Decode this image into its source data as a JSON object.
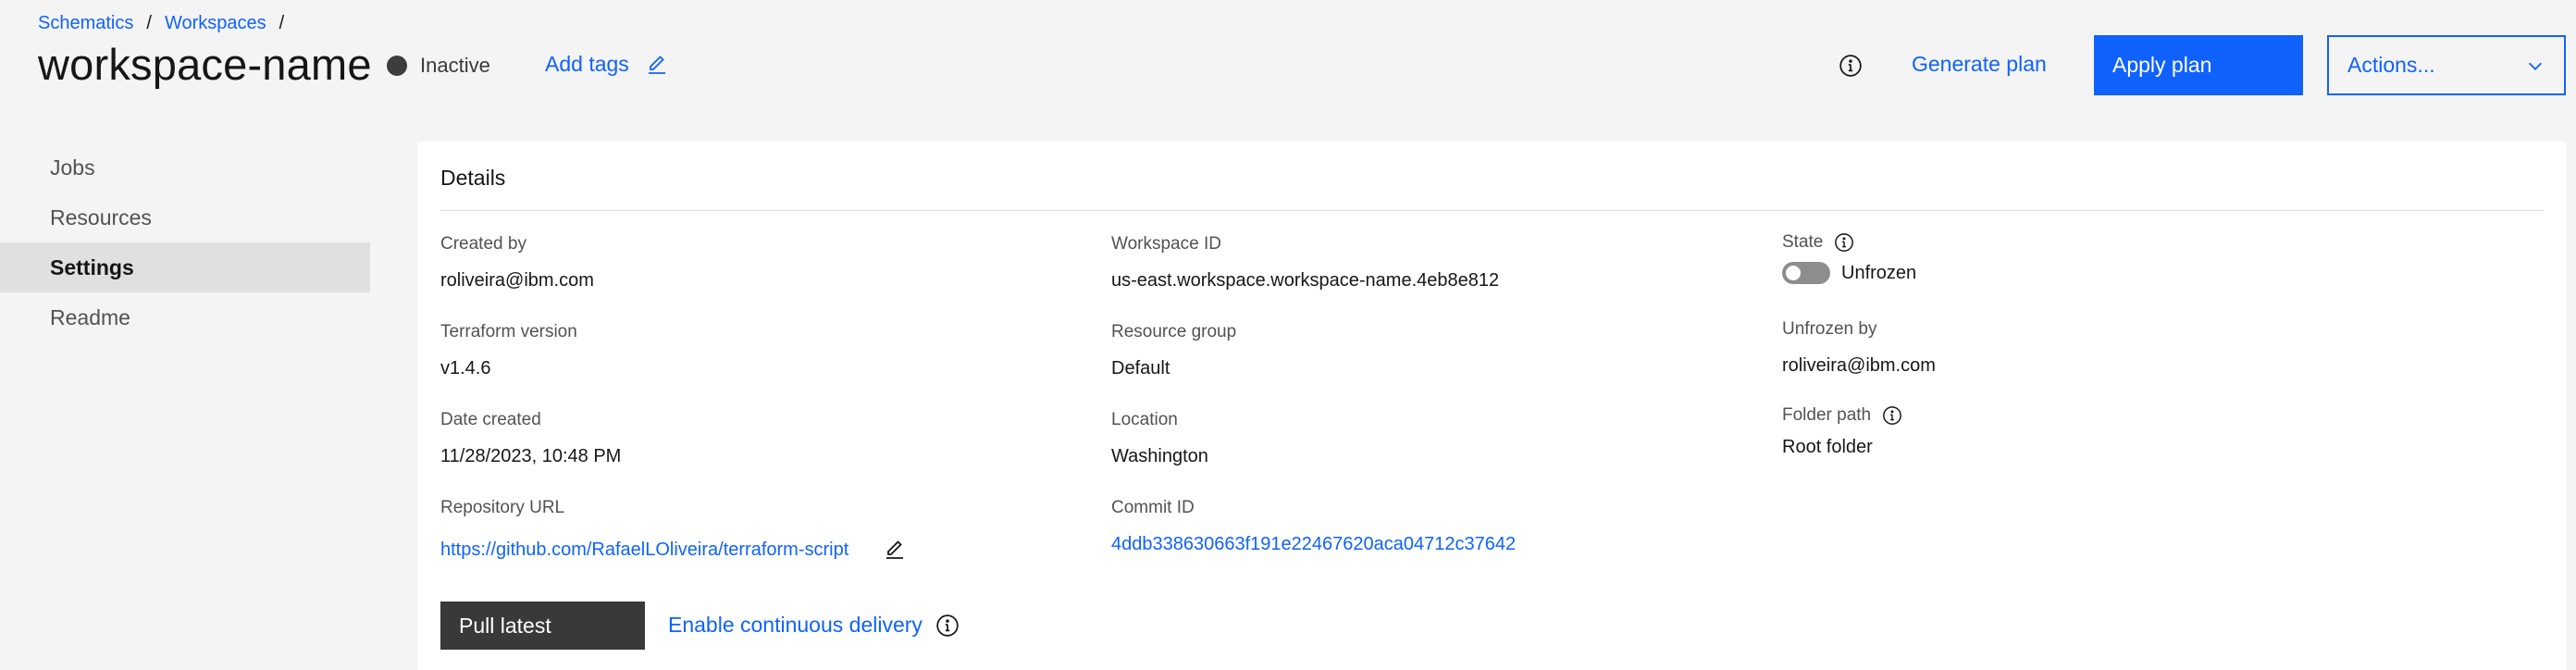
{
  "breadcrumb": {
    "items": [
      "Schematics",
      "Workspaces"
    ],
    "separator": "/"
  },
  "header": {
    "title": "workspace-name",
    "status": "Inactive",
    "add_tags": "Add tags",
    "generate_plan": "Generate plan",
    "apply_plan": "Apply plan",
    "actions": "Actions..."
  },
  "sidebar": {
    "items": [
      {
        "label": "Jobs",
        "active": false
      },
      {
        "label": "Resources",
        "active": false
      },
      {
        "label": "Settings",
        "active": true
      },
      {
        "label": "Readme",
        "active": false
      }
    ]
  },
  "details": {
    "title": "Details",
    "created_by": {
      "label": "Created by",
      "value": "roliveira@ibm.com"
    },
    "terraform_version": {
      "label": "Terraform version",
      "value": "v1.4.6"
    },
    "date_created": {
      "label": "Date created",
      "value": "11/28/2023, 10:48 PM"
    },
    "repository_url": {
      "label": "Repository URL",
      "value": "https://github.com/RafaelLOliveira/terraform-script"
    },
    "workspace_id": {
      "label": "Workspace ID",
      "value": "us-east.workspace.workspace-name.4eb8e812"
    },
    "resource_group": {
      "label": "Resource group",
      "value": "Default"
    },
    "location": {
      "label": "Location",
      "value": "Washington"
    },
    "commit_id": {
      "label": "Commit ID",
      "value": "4ddb338630663f191e22467620aca04712c37642"
    },
    "state": {
      "label": "State",
      "value": "Unfrozen"
    },
    "unfrozen_by": {
      "label": "Unfrozen by",
      "value": "roliveira@ibm.com"
    },
    "folder_path": {
      "label": "Folder path",
      "value": "Root folder"
    },
    "pull_latest": "Pull latest",
    "continuous_delivery": "Enable continuous delivery"
  },
  "colors": {
    "accent": "#0f62fe",
    "background": "#f4f4f4",
    "dark_button": "#393939"
  }
}
